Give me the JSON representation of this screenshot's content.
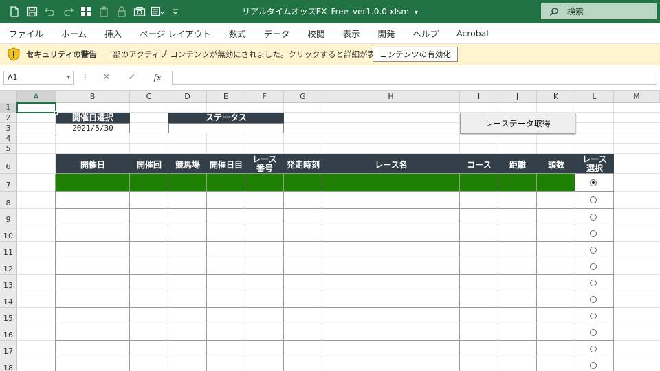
{
  "titlebar": {
    "document_title": "リアルタイムオッズEX_Free_ver1.0.0.xlsm",
    "title_dropdown": "▾",
    "search_placeholder": "検索",
    "qat_icons": [
      "new-file-icon",
      "save-icon",
      "undo-icon",
      "redo-icon",
      "layout-icon",
      "paste-special-icon",
      "lock-icon",
      "camera-icon",
      "form-icon",
      "customize-qat-icon"
    ]
  },
  "ribbon": {
    "tabs": [
      "ファイル",
      "ホーム",
      "挿入",
      "ページ レイアウト",
      "数式",
      "データ",
      "校閲",
      "表示",
      "開発",
      "ヘルプ",
      "Acrobat"
    ]
  },
  "security_bar": {
    "title": "セキュリティの警告",
    "message": "一部のアクティブ コンテンツが無効にされました。クリックすると詳細が表示されます。",
    "button_label": "コンテンツの有効化"
  },
  "formula_bar": {
    "name_box": "A1",
    "separator": "⋮",
    "cancel": "✕",
    "enter": "✓",
    "fx": "fx",
    "value": ""
  },
  "sheet": {
    "columns": [
      "A",
      "B",
      "C",
      "D",
      "E",
      "F",
      "G",
      "H",
      "I",
      "J",
      "K",
      "L",
      "M"
    ],
    "rows": [
      "1",
      "2",
      "3",
      "4",
      "5",
      "6",
      "7",
      "8",
      "9",
      "10",
      "11",
      "12",
      "13",
      "14",
      "15",
      "16",
      "17",
      "18"
    ],
    "date_select_label": "開催日選択",
    "date_value": "2021/5/30",
    "status_label": "ステータス",
    "status_value": "",
    "fetch_button": "レースデータ取得",
    "table_headers": [
      "開催日",
      "開催回",
      "競馬場",
      "開催日目",
      "レース番号",
      "発走時刻",
      "レース名",
      "コース",
      "距離",
      "頭数",
      "レース選択"
    ],
    "table_header_lines": {
      "race_number": [
        "レース",
        "番号"
      ],
      "race_select": [
        "レース",
        "選択"
      ]
    },
    "selected_radio_row": 7,
    "colors": {
      "header_dark": "#333f48",
      "row_highlight": "#1e8000",
      "excel_green": "#217346"
    }
  }
}
